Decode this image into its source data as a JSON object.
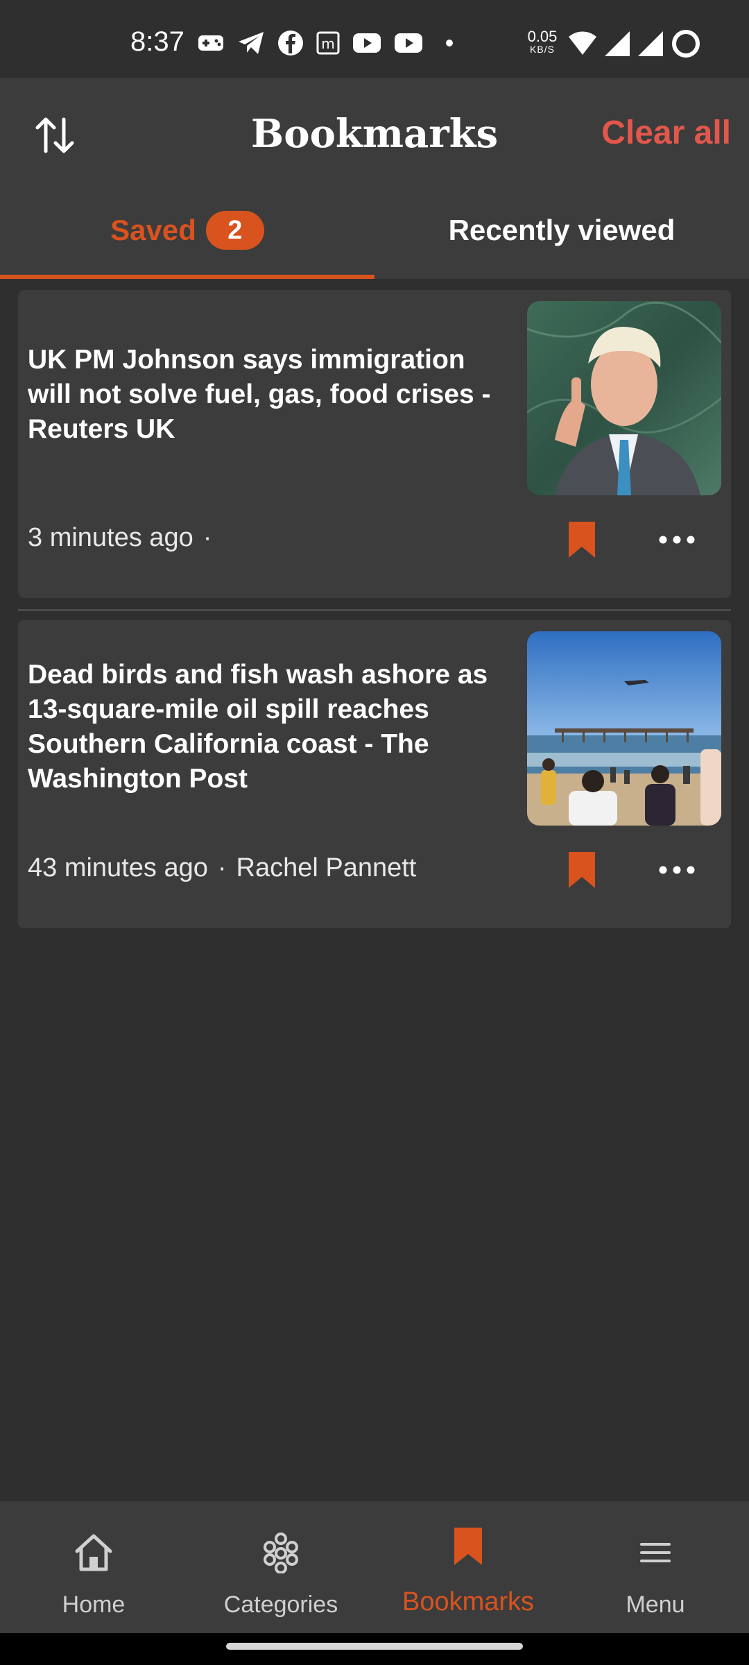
{
  "status_bar": {
    "time": "8:37",
    "net_speed_value": "0.05",
    "net_speed_unit": "KB/S",
    "icons": [
      "game-icon",
      "telegram-icon",
      "facebook-icon",
      "m-icon",
      "youtube-icon",
      "youtube-icon",
      "dot-icon",
      "wifi-icon",
      "signal-icon",
      "signal-icon",
      "battery-ring-icon"
    ]
  },
  "header": {
    "title": "Bookmarks",
    "clear_all": "Clear all",
    "sort_icon": "sort-arrows-icon"
  },
  "tabs": {
    "saved_label": "Saved",
    "saved_count": "2",
    "recent_label": "Recently viewed"
  },
  "articles": [
    {
      "title": "UK PM Johnson says immigration will not solve fuel, gas, food crises - Reuters UK",
      "time": "3 minutes ago",
      "dot": "·",
      "author": ""
    },
    {
      "title": "Dead birds and fish wash ashore as 13-square-mile oil spill reaches Southern California coast - The Washington Post",
      "time": "43 minutes ago",
      "dot": "·",
      "author": "Rachel Pannett"
    }
  ],
  "bottom_nav": {
    "home": "Home",
    "categories": "Categories",
    "bookmarks": "Bookmarks",
    "menu": "Menu"
  },
  "colors": {
    "accent": "#d9531e",
    "clear_all": "#e2574c",
    "background": "#2f2f2f",
    "surface": "#3c3c3c"
  }
}
